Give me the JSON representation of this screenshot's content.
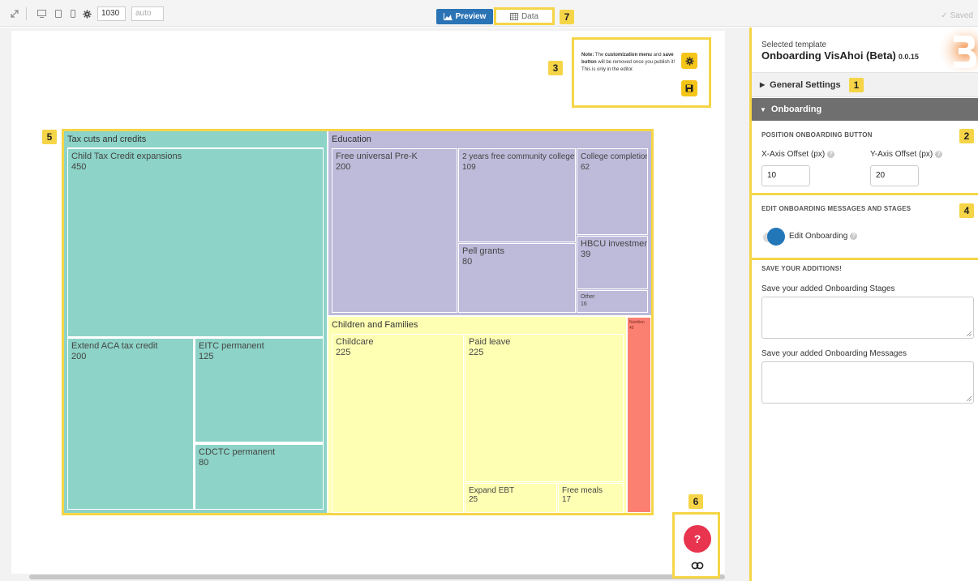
{
  "toolbar": {
    "width_value": "1030",
    "height_placeholder": "auto",
    "preview_label": "Preview",
    "data_label": "Data",
    "saved_label": "Saved"
  },
  "badges": {
    "b1": "1",
    "b2": "2",
    "b3": "3",
    "b4": "4",
    "b5": "5",
    "b6": "6",
    "b7": "7"
  },
  "note": {
    "prefix": "Note:",
    "t1": " The ",
    "b1": "customization menu",
    "t2": " and ",
    "b2": "save button",
    "t3": " will be removed once you publish it! This is only in the editor."
  },
  "treemap": {
    "groups": {
      "tax": {
        "name": "Tax cuts and credits",
        "color": "#8dd3c7"
      },
      "edu": {
        "name": "Education",
        "color": "#bebada"
      },
      "kids": {
        "name": "Children and Families",
        "color": "#ffffb3"
      },
      "nutrition": {
        "name": "Nutrition",
        "value": "45",
        "color": "#fb8072"
      }
    },
    "cells": {
      "ctc": {
        "name": "Child Tax Credit expansions",
        "value": "450"
      },
      "aca": {
        "name": "Extend ACA tax credit",
        "value": "200"
      },
      "eitc": {
        "name": "EITC permanent",
        "value": "125"
      },
      "cdctc": {
        "name": "CDCTC permanent",
        "value": "80"
      },
      "prek": {
        "name": "Free universal Pre-K",
        "value": "200"
      },
      "cc": {
        "name": "2 years free community college",
        "value": "109"
      },
      "completion": {
        "name": "College completion",
        "value": "62"
      },
      "pell": {
        "name": "Pell grants",
        "value": "80"
      },
      "hbcu": {
        "name": "HBCU investment",
        "value": "39"
      },
      "other": {
        "name": "Other",
        "value": "16"
      },
      "childcare": {
        "name": "Childcare",
        "value": "225"
      },
      "leave": {
        "name": "Paid leave",
        "value": "225"
      },
      "ebt": {
        "name": "Expand EBT",
        "value": "25"
      },
      "meals": {
        "name": "Free meals",
        "value": "17"
      }
    }
  },
  "help": {
    "label": "?"
  },
  "sidebar": {
    "template_label": "Selected template",
    "template_name": "Onboarding VisAhoi (Beta)",
    "template_version": "0.0.15",
    "general_settings": "General Settings",
    "onboarding": "Onboarding",
    "position_heading": "POSITION ONBOARDING BUTTON",
    "x_label": "X-Axis Offset (px)",
    "x_value": "10",
    "y_label": "Y-Axis Offset (px)",
    "y_value": "20",
    "edit_heading": "EDIT ONBOARDING MESSAGES AND STAGES",
    "edit_toggle_label": "Edit Onboarding",
    "save_heading": "SAVE YOUR ADDITIONS!",
    "stages_label": "Save your added Onboarding Stages",
    "messages_label": "Save your added Onboarding Messages"
  }
}
